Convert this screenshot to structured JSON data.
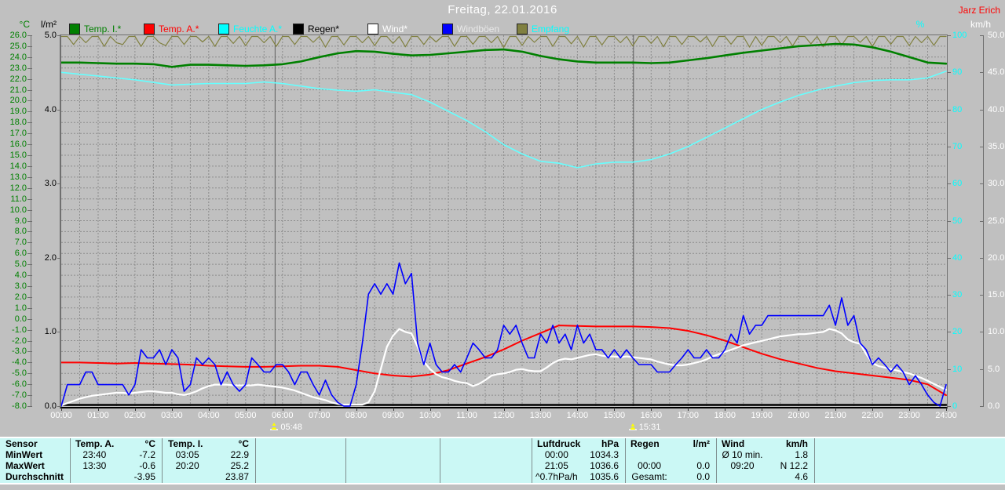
{
  "window": {
    "title": "Freitag, 22.01.2016",
    "author": "Jarz Erich"
  },
  "axes": {
    "left_temp": {
      "caption": "°C",
      "color": "#008000",
      "max": 26,
      "min": -8,
      "step": 1
    },
    "left_rain": {
      "caption": "l/m²",
      "color": "#000000",
      "max": 5,
      "min": 0,
      "step": 1
    },
    "right_humidity": {
      "caption": "%",
      "color": "#00ffff",
      "max": 100,
      "min": 0,
      "step": 10
    },
    "right_wind": {
      "caption": "km/h",
      "color": "#ffffff",
      "max": 50,
      "min": 0,
      "step": 5
    }
  },
  "legend": [
    {
      "label": "Temp. I.*",
      "swatch": "#008000",
      "text": "#008000"
    },
    {
      "label": "Temp. A.*",
      "swatch": "#ff0000",
      "text": "#ff0000"
    },
    {
      "label": "Feuchte A.*",
      "swatch": "#00ffff",
      "text": "#00ffff"
    },
    {
      "label": "Regen*",
      "swatch": "#000000",
      "text": "#000000"
    },
    {
      "label": "Wind*",
      "swatch": "#ffffff",
      "text": "#ffffff"
    },
    {
      "label": "Windböen",
      "swatch": "#0000ff",
      "text": "#e8e8e8"
    },
    {
      "label": "Empfang",
      "swatch": "#808040",
      "text": "#00ffff"
    }
  ],
  "markers": [
    {
      "label": "05:48",
      "hour": 5.8,
      "type": "sunrise"
    },
    {
      "label": "15:31",
      "hour": 15.52,
      "type": "sunset"
    }
  ],
  "chart_data": {
    "type": "line",
    "title": "Freitag, 22.01.2016",
    "x_labels": [
      "00:00",
      "01:00",
      "02:00",
      "03:00",
      "04:00",
      "05:00",
      "06:00",
      "07:00",
      "08:00",
      "09:00",
      "10:00",
      "11:00",
      "12:00",
      "13:00",
      "14:00",
      "15:00",
      "16:00",
      "17:00",
      "18:00",
      "19:00",
      "20:00",
      "21:00",
      "22:00",
      "23:00",
      "24:00"
    ],
    "x_range_hours": [
      0,
      24
    ],
    "grid": true,
    "axes_ranges": {
      "temp_c": [
        -8,
        26
      ],
      "rain_lm2": [
        0,
        5
      ],
      "humidity_pct": [
        0,
        100
      ],
      "wind_kmh": [
        0,
        50
      ]
    },
    "series": [
      {
        "name": "Temp. I.",
        "unit": "°C",
        "color": "#008000",
        "axis": "temp_c",
        "step_h": 0.5,
        "values": [
          23.5,
          23.5,
          23.45,
          23.4,
          23.4,
          23.35,
          23.1,
          23.3,
          23.3,
          23.25,
          23.2,
          23.25,
          23.35,
          23.6,
          24.0,
          24.35,
          24.55,
          24.5,
          24.3,
          24.15,
          24.2,
          24.35,
          24.5,
          24.65,
          24.7,
          24.5,
          24.1,
          23.8,
          23.6,
          23.5,
          23.5,
          23.5,
          23.45,
          23.5,
          23.7,
          23.9,
          24.15,
          24.4,
          24.6,
          24.8,
          25.0,
          25.1,
          25.2,
          25.15,
          24.9,
          24.5,
          24.0,
          23.5,
          23.4
        ]
      },
      {
        "name": "Temp. A.",
        "unit": "°C",
        "color": "#ff0000",
        "axis": "temp_c",
        "step_h": 0.5,
        "values": [
          -4.0,
          -4.0,
          -4.05,
          -4.1,
          -4.05,
          -4.1,
          -4.15,
          -4.2,
          -4.3,
          -4.35,
          -4.4,
          -4.4,
          -4.35,
          -4.3,
          -4.3,
          -4.4,
          -4.7,
          -5.0,
          -5.2,
          -5.3,
          -5.1,
          -4.7,
          -4.1,
          -3.5,
          -2.8,
          -2.0,
          -1.3,
          -0.6,
          -0.65,
          -0.7,
          -0.7,
          -0.7,
          -0.75,
          -0.85,
          -1.1,
          -1.5,
          -2.0,
          -2.6,
          -3.2,
          -3.7,
          -4.1,
          -4.5,
          -4.8,
          -5.0,
          -5.2,
          -5.4,
          -5.6,
          -6.0,
          -7.0
        ]
      },
      {
        "name": "Feuchte A.",
        "unit": "%",
        "color": "#66ffff",
        "axis": "humidity_pct",
        "step_h": 0.5,
        "values": [
          90,
          89.5,
          89,
          88.5,
          88,
          87.3,
          86.6,
          86.8,
          87,
          87,
          87,
          87.4,
          87,
          86.3,
          85.6,
          85.2,
          84.9,
          85.3,
          84.6,
          84,
          82,
          79.5,
          77,
          74,
          70.5,
          68,
          66,
          65.5,
          64.3,
          65.3,
          65.8,
          65.8,
          66.5,
          68,
          70,
          72.5,
          75,
          77.5,
          80,
          82,
          83.8,
          85.2,
          86.3,
          87.2,
          87.8,
          88,
          88,
          88.5,
          90.3
        ]
      },
      {
        "name": "Regen",
        "unit": "l/m²",
        "color": "#000000",
        "axis": "rain_lm2",
        "step_h": 1,
        "values": [
          0,
          0,
          0,
          0,
          0,
          0,
          0,
          0,
          0,
          0,
          0,
          0,
          0,
          0,
          0,
          0,
          0,
          0,
          0,
          0,
          0,
          0,
          0,
          0,
          0
        ]
      },
      {
        "name": "Wind",
        "unit": "km/h",
        "color": "#ffffff",
        "axis": "wind_kmh",
        "step_h": 0.16667,
        "values": [
          0.1,
          0.4,
          0.7,
          1.0,
          1.2,
          1.4,
          1.5,
          1.6,
          1.7,
          1.8,
          1.8,
          1.7,
          1.8,
          1.9,
          2.0,
          2.0,
          1.9,
          1.8,
          1.8,
          1.6,
          1.5,
          1.7,
          2.0,
          2.4,
          2.7,
          2.9,
          2.9,
          2.9,
          2.8,
          2.8,
          2.8,
          2.8,
          2.9,
          2.8,
          2.7,
          2.6,
          2.5,
          2.3,
          2.1,
          1.8,
          1.5,
          1.2,
          1.0,
          0.8,
          0.5,
          0.3,
          0.2,
          0.2,
          0.2,
          0.2,
          0.5,
          2.0,
          5.0,
          8.0,
          9.5,
          10.4,
          10.0,
          9.8,
          8.0,
          6.0,
          5.0,
          4.3,
          3.9,
          3.7,
          3.4,
          3.2,
          3.1,
          2.7,
          3.0,
          3.5,
          4.1,
          4.3,
          4.4,
          4.6,
          4.9,
          5.0,
          4.8,
          4.7,
          4.7,
          5.2,
          5.8,
          6.2,
          6.4,
          6.3,
          6.5,
          6.7,
          6.9,
          7.0,
          6.8,
          6.7,
          6.7,
          6.6,
          6.7,
          6.6,
          6.5,
          6.4,
          6.3,
          6.0,
          5.8,
          5.6,
          5.5,
          5.5,
          5.6,
          5.8,
          6.0,
          6.3,
          6.7,
          7.0,
          7.3,
          7.6,
          7.9,
          8.2,
          8.4,
          8.6,
          8.8,
          9.0,
          9.2,
          9.4,
          9.5,
          9.6,
          9.7,
          9.7,
          9.8,
          9.9,
          10.0,
          10.4,
          10.2,
          9.8,
          9.0,
          8.6,
          8.4,
          7.0,
          5.8,
          5.4,
          5.2,
          5.0,
          4.8,
          4.6,
          4.4,
          4.1,
          3.8,
          3.4,
          3.0,
          2.6,
          2.2
        ]
      },
      {
        "name": "Windböen",
        "unit": "km/h",
        "color": "#0000ff",
        "axis": "wind_kmh",
        "step_h": 0.16667,
        "values": [
          0,
          2.9,
          2.9,
          2.9,
          4.6,
          4.6,
          2.9,
          2.9,
          2.9,
          2.9,
          2.9,
          1.5,
          2.9,
          7.6,
          6.5,
          6.5,
          7.6,
          5.6,
          7.6,
          6.5,
          2.0,
          2.9,
          6.5,
          5.6,
          6.5,
          5.6,
          2.9,
          4.6,
          2.9,
          2.0,
          2.9,
          6.5,
          5.6,
          4.6,
          4.6,
          5.6,
          5.6,
          4.6,
          2.9,
          4.6,
          4.6,
          2.9,
          1.5,
          3.5,
          1.5,
          0.5,
          0,
          0,
          2.9,
          8.5,
          15.1,
          16.5,
          15.1,
          16.5,
          15.1,
          19.3,
          16.5,
          17.9,
          8.5,
          5.6,
          8.5,
          5.6,
          4.6,
          4.6,
          5.6,
          4.6,
          6.5,
          8.5,
          7.6,
          6.5,
          6.5,
          7.6,
          10.9,
          9.7,
          10.9,
          8.5,
          6.5,
          6.5,
          9.7,
          8.5,
          10.9,
          8.5,
          9.7,
          7.6,
          10.9,
          8.5,
          9.7,
          7.6,
          7.6,
          6.5,
          7.6,
          6.5,
          7.6,
          6.5,
          5.6,
          5.6,
          5.6,
          4.6,
          4.6,
          4.6,
          5.6,
          6.5,
          7.6,
          6.5,
          6.5,
          7.6,
          6.5,
          6.5,
          7.6,
          9.7,
          8.5,
          12.2,
          9.7,
          10.9,
          10.9,
          12.2,
          12.2,
          12.2,
          12.2,
          12.2,
          12.2,
          12.2,
          12.2,
          12.2,
          12.2,
          13.6,
          10.9,
          14.6,
          10.9,
          12.2,
          8.5,
          7.6,
          5.6,
          6.5,
          5.6,
          4.6,
          5.6,
          4.6,
          2.9,
          4.1,
          2.9,
          1.5,
          0.5,
          0,
          2.9
        ]
      },
      {
        "name": "Empfang",
        "unit": "%",
        "color": "#808040",
        "axis": "humidity_pct",
        "step_h": 0.16667,
        "values": [
          100,
          100,
          97.5,
          100,
          98,
          100,
          100,
          97,
          100,
          98,
          97.5,
          100,
          100,
          97,
          100,
          100,
          98,
          97.2,
          100,
          100,
          97.5,
          100,
          100,
          98.2,
          100,
          97,
          100,
          100,
          97.8,
          100,
          97.2,
          100,
          100,
          98,
          100,
          97,
          100,
          100,
          97.5,
          100,
          100,
          98.1,
          100,
          96.8,
          100,
          100,
          97.4,
          100,
          100,
          98,
          100,
          97.2,
          100,
          100,
          97.8,
          100,
          96.9,
          100,
          100,
          97.5,
          100,
          98.2,
          100,
          100,
          97,
          100,
          100,
          97.6,
          100,
          100,
          98,
          100,
          96.7,
          100,
          100,
          97.3,
          100,
          98.1,
          100,
          100,
          97,
          100,
          100,
          97.7,
          100,
          96.8,
          100,
          100,
          97.4,
          100,
          100,
          98,
          100,
          97.1,
          100,
          100,
          97.8,
          100,
          96.9,
          100,
          100,
          97.5,
          100,
          100,
          98.2,
          100,
          97,
          100,
          100,
          97.6,
          100,
          100,
          96.8,
          100,
          97.3,
          100,
          100,
          98,
          100,
          97.1,
          100,
          100,
          97.7,
          100,
          96.9,
          100,
          100,
          97.4,
          100,
          100,
          98.1,
          100,
          97,
          100,
          100,
          97.6,
          100,
          100,
          97.2,
          100,
          98,
          100,
          97.3,
          100,
          100
        ]
      }
    ]
  },
  "table": {
    "row_labels": [
      "Sensor",
      "MinWert",
      "MaxWert",
      "Durchschnitt"
    ],
    "columns": [
      {
        "name": "Temp. A.",
        "unit": "°C",
        "rows": [
          [
            "23:40",
            "-7.2"
          ],
          [
            "13:30",
            "-0.6"
          ],
          [
            "",
            "-3.95"
          ]
        ]
      },
      {
        "name": "Temp. I.",
        "unit": "°C",
        "rows": [
          [
            "03:05",
            "22.9"
          ],
          [
            "20:20",
            "25.2"
          ],
          [
            "",
            "23.87"
          ]
        ]
      },
      {
        "name": "",
        "unit": "",
        "rows": [
          [
            "",
            ""
          ],
          [
            "",
            ""
          ],
          [
            "",
            ""
          ]
        ]
      },
      {
        "name": "",
        "unit": "",
        "rows": [
          [
            "",
            ""
          ],
          [
            "",
            ""
          ],
          [
            "",
            ""
          ]
        ]
      },
      {
        "name": "",
        "unit": "",
        "rows": [
          [
            "",
            ""
          ],
          [
            "",
            ""
          ],
          [
            "",
            ""
          ]
        ]
      },
      {
        "name": "Luftdruck",
        "unit": "hPa",
        "rows": [
          [
            "00:00",
            "1034.3"
          ],
          [
            "21:05",
            "1036.6"
          ],
          [
            "^0.7hPa/h",
            "1035.6"
          ]
        ]
      },
      {
        "name": "Regen",
        "unit": "l/m²",
        "rows": [
          [
            "",
            ""
          ],
          [
            "00:00",
            "0.0"
          ],
          [
            "Gesamt:",
            "0.0"
          ]
        ]
      },
      {
        "name": "Wind",
        "unit": "km/h",
        "rows": [
          [
            "Ø 10 min.",
            "1.8"
          ],
          [
            "09:20",
            "N 12.2"
          ],
          [
            "",
            "4.6"
          ]
        ]
      }
    ]
  }
}
